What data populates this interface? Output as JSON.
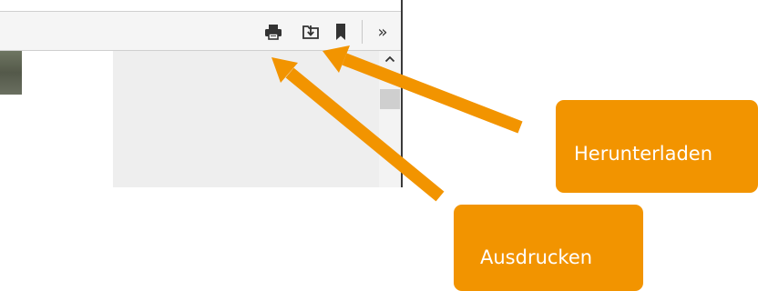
{
  "toolbar": {
    "buttons": [
      {
        "icon": "printer-icon"
      },
      {
        "icon": "download-icon"
      },
      {
        "icon": "bookmark-icon"
      }
    ],
    "more_label": "»"
  },
  "scrollbar": {
    "up_icon": "chevron-up-icon"
  },
  "callouts": {
    "download_label": "Herunterladen",
    "print_label": "Ausdrucken"
  },
  "colors": {
    "accent": "#f29400",
    "toolbar_bg": "#f5f5f5",
    "panel_bg": "#eeeeee",
    "icon": "#333333"
  }
}
